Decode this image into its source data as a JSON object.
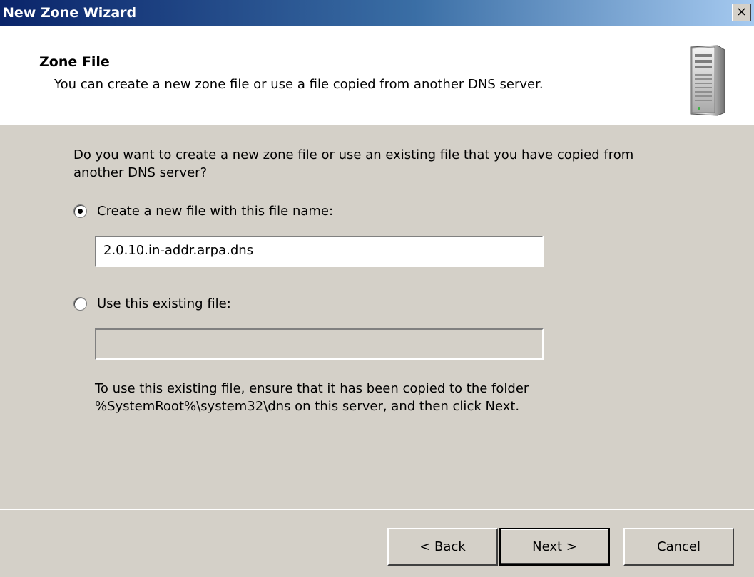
{
  "window": {
    "title": "New Zone Wizard",
    "close_glyph": "×",
    "close_icon": "close-icon"
  },
  "header": {
    "title": "Zone File",
    "subtitle": "You can create a new zone file or use a file copied from another DNS server.",
    "icon": "server-icon"
  },
  "main": {
    "question": "Do you want to create a new zone file or use an existing file that you have copied from another DNS server?",
    "options": [
      {
        "label": "Create a new file with this file name:",
        "selected": true
      },
      {
        "label": "Use this existing file:",
        "selected": false
      }
    ],
    "new_file_value": "2.0.10.in-addr.arpa.dns",
    "existing_file_value": "",
    "note": "To use this existing file, ensure that it has been copied to the folder %SystemRoot%\\system32\\dns on this server, and then click Next."
  },
  "buttons": {
    "back": "< Back",
    "next": "Next >",
    "cancel": "Cancel"
  },
  "colors": {
    "dialog_bg": "#d4d0c8",
    "titlebar_start": "#0a246a",
    "titlebar_end": "#a6caf0"
  }
}
